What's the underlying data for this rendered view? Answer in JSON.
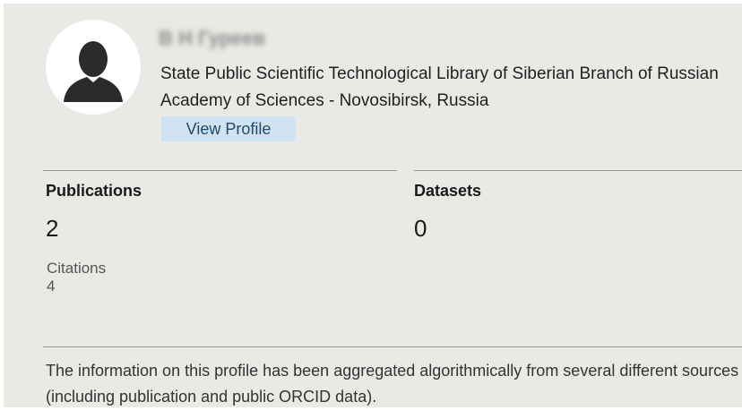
{
  "profile": {
    "name": "В Н Гуреев",
    "affiliation": "State Public Scientific Technological Library of Siberian Branch of Russian Academy of Sciences - Novosibirsk, Russia",
    "view_profile_label": "View Profile",
    "avatar_icon": "user-silhouette-icon"
  },
  "stats": {
    "publications_label": "Publications",
    "publications_value": "2",
    "datasets_label": "Datasets",
    "datasets_value": "0",
    "citations_label": "Citations",
    "citations_value": "4"
  },
  "footer": {
    "info_text": "The information on this profile has been aggregated algorithmically from several different sources (including publication and public ORCID data)."
  },
  "colors": {
    "card_background": "#ebe9e5",
    "button_background": "#cfe3f2",
    "avatar_silhouette": "#2b2b2b"
  }
}
